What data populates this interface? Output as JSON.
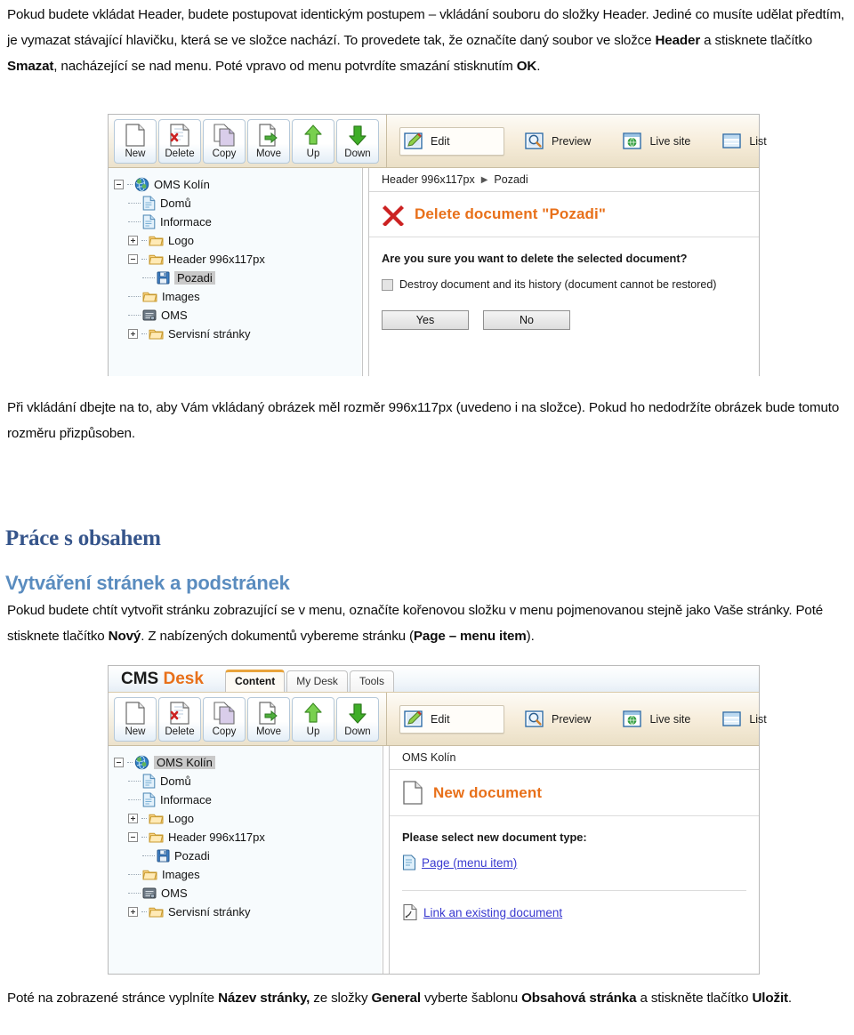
{
  "doc": {
    "para1": [
      {
        "t": "Pokud budete vkládat Header, budete postupovat identickým postupem – vkládání souboru do složky Header. Jediné co musíte udělat předtím, je vymazat stávající hlavičku, která se ve složce nachází. To provedete tak, že označíte daný soubor ve složce ",
        "b": false
      },
      {
        "t": "Header",
        "b": true
      },
      {
        "t": " a stisknete tlačítko ",
        "b": false
      },
      {
        "t": "Smazat",
        "b": true
      },
      {
        "t": ", nacházející se nad menu. Poté vpravo od menu potvrdíte smazání stisknutím ",
        "b": false
      },
      {
        "t": "OK",
        "b": true
      },
      {
        "t": ".",
        "b": false
      }
    ],
    "para2": [
      {
        "t": "Při vkládání dbejte na to, aby Vám vkládaný obrázek měl rozměr 996x117px (uvedeno i na složce). Pokud ho nedodržíte obrázek bude tomuto rozměru přizpůsoben.",
        "b": false
      }
    ],
    "section_title": "Práce s obsahem",
    "sub_title": "Vytváření stránek a podstránek",
    "para3": [
      {
        "t": "Pokud budete chtít vytvořit stránku zobrazující se v menu, označíte kořenovou složku v menu pojmenovanou stejně jako Vaše stránky. Poté stisknete tlačítko ",
        "b": false
      },
      {
        "t": "Nový",
        "b": true
      },
      {
        "t": ". Z nabízených dokumentů vybereme stránku (",
        "b": false
      },
      {
        "t": "Page – menu item",
        "b": true
      },
      {
        "t": ").",
        "b": false
      }
    ],
    "para4": [
      {
        "t": "Poté na zobrazené stránce vyplníte ",
        "b": false
      },
      {
        "t": "Název stránky,",
        "b": true
      },
      {
        "t": " ze složky ",
        "b": false
      },
      {
        "t": "General",
        "b": true
      },
      {
        "t": " vyberte šablonu ",
        "b": false
      },
      {
        "t": "Obsahová stránka",
        "b": true
      },
      {
        "t": " a stiskněte tlačítko ",
        "b": false
      },
      {
        "t": "Uložit",
        "b": true
      },
      {
        "t": ".",
        "b": false
      }
    ]
  },
  "colors": {
    "heading_dark_blue": "#36558b",
    "heading_light_blue": "#5a8cbf",
    "accent_orange": "#e8701a",
    "link_blue": "#3a3ad0",
    "toolbar_tan": "#eadfc6",
    "tree_bg": "#f7fbfd"
  },
  "shot1": {
    "toolbar": {
      "buttons": [
        {
          "label": "New",
          "icon": "new-document-icon"
        },
        {
          "label": "Delete",
          "icon": "delete-document-icon"
        },
        {
          "label": "Copy",
          "icon": "copy-document-icon"
        },
        {
          "label": "Move",
          "icon": "move-document-icon"
        },
        {
          "label": "Up",
          "icon": "arrow-up-icon"
        },
        {
          "label": "Down",
          "icon": "arrow-down-icon"
        }
      ],
      "view_buttons": [
        {
          "label": "Edit",
          "icon": "edit-pencil-icon",
          "selected": true
        },
        {
          "label": "Preview",
          "icon": "magnifier-icon",
          "selected": false
        },
        {
          "label": "Live site",
          "icon": "globe-window-icon",
          "selected": false
        },
        {
          "label": "List",
          "icon": "list-icon",
          "selected": false
        }
      ]
    },
    "tree": [
      {
        "label": "OMS Kolín",
        "depth": 0,
        "expander": "minus",
        "icon": "globe-icon",
        "selected": false
      },
      {
        "label": "Domů",
        "depth": 1,
        "expander": "none",
        "icon": "page-icon",
        "selected": false
      },
      {
        "label": "Informace",
        "depth": 1,
        "expander": "none",
        "icon": "page-icon",
        "selected": false
      },
      {
        "label": "Logo",
        "depth": 1,
        "expander": "plus",
        "icon": "folder-icon",
        "selected": false
      },
      {
        "label": "Header 996x117px",
        "depth": 1,
        "expander": "minus",
        "icon": "folder-icon",
        "selected": false
      },
      {
        "label": "Pozadi",
        "depth": 2,
        "expander": "none",
        "icon": "file-save-icon",
        "selected": true
      },
      {
        "label": "Images",
        "depth": 1,
        "expander": "none",
        "icon": "folder-icon",
        "selected": false
      },
      {
        "label": "OMS",
        "depth": 1,
        "expander": "none",
        "icon": "oms-icon",
        "selected": false
      },
      {
        "label": "Servisní stránky",
        "depth": 1,
        "expander": "plus",
        "icon": "folder-icon",
        "selected": false
      }
    ],
    "breadcrumb": [
      "Header 996x117px",
      "Pozadi"
    ],
    "panel": {
      "title": "Delete document \"Pozadi\"",
      "title_icon": "red-x-icon",
      "question": "Are you sure you want to delete the selected document?",
      "checkbox_label": "Destroy document and its history (document cannot be restored)",
      "checkbox_checked": false,
      "buttons": [
        "Yes",
        "No"
      ]
    }
  },
  "shot2": {
    "logo": {
      "cms": "CMS",
      "desk": "Desk"
    },
    "tabs": [
      {
        "label": "Content",
        "active": true
      },
      {
        "label": "My Desk",
        "active": false
      },
      {
        "label": "Tools",
        "active": false
      }
    ],
    "toolbar": {
      "buttons": [
        {
          "label": "New",
          "icon": "new-document-icon"
        },
        {
          "label": "Delete",
          "icon": "delete-document-icon"
        },
        {
          "label": "Copy",
          "icon": "copy-document-icon"
        },
        {
          "label": "Move",
          "icon": "move-document-icon"
        },
        {
          "label": "Up",
          "icon": "arrow-up-icon"
        },
        {
          "label": "Down",
          "icon": "arrow-down-icon"
        }
      ],
      "view_buttons": [
        {
          "label": "Edit",
          "icon": "edit-pencil-icon",
          "selected": true
        },
        {
          "label": "Preview",
          "icon": "magnifier-icon",
          "selected": false
        },
        {
          "label": "Live site",
          "icon": "globe-window-icon",
          "selected": false
        },
        {
          "label": "List",
          "icon": "list-icon",
          "selected": false
        }
      ]
    },
    "tree": [
      {
        "label": "OMS Kolín",
        "depth": 0,
        "expander": "minus",
        "icon": "globe-icon",
        "selected": true
      },
      {
        "label": "Domů",
        "depth": 1,
        "expander": "none",
        "icon": "page-icon",
        "selected": false
      },
      {
        "label": "Informace",
        "depth": 1,
        "expander": "none",
        "icon": "page-icon",
        "selected": false
      },
      {
        "label": "Logo",
        "depth": 1,
        "expander": "plus",
        "icon": "folder-icon",
        "selected": false
      },
      {
        "label": "Header 996x117px",
        "depth": 1,
        "expander": "minus",
        "icon": "folder-icon",
        "selected": false
      },
      {
        "label": "Pozadi",
        "depth": 2,
        "expander": "none",
        "icon": "file-save-icon",
        "selected": false
      },
      {
        "label": "Images",
        "depth": 1,
        "expander": "none",
        "icon": "folder-icon",
        "selected": false
      },
      {
        "label": "OMS",
        "depth": 1,
        "expander": "none",
        "icon": "oms-icon",
        "selected": false
      },
      {
        "label": "Servisní stránky",
        "depth": 1,
        "expander": "plus",
        "icon": "folder-icon",
        "selected": false
      }
    ],
    "breadcrumb": [
      "OMS Kolín"
    ],
    "panel": {
      "title": "New document",
      "title_icon": "blank-page-icon",
      "prompt": "Please select new document type:",
      "doc_types": [
        {
          "label": "Page (menu item)",
          "icon": "page-icon"
        }
      ],
      "link_existing": {
        "label": "Link an existing document",
        "icon": "linked-page-icon"
      }
    }
  }
}
